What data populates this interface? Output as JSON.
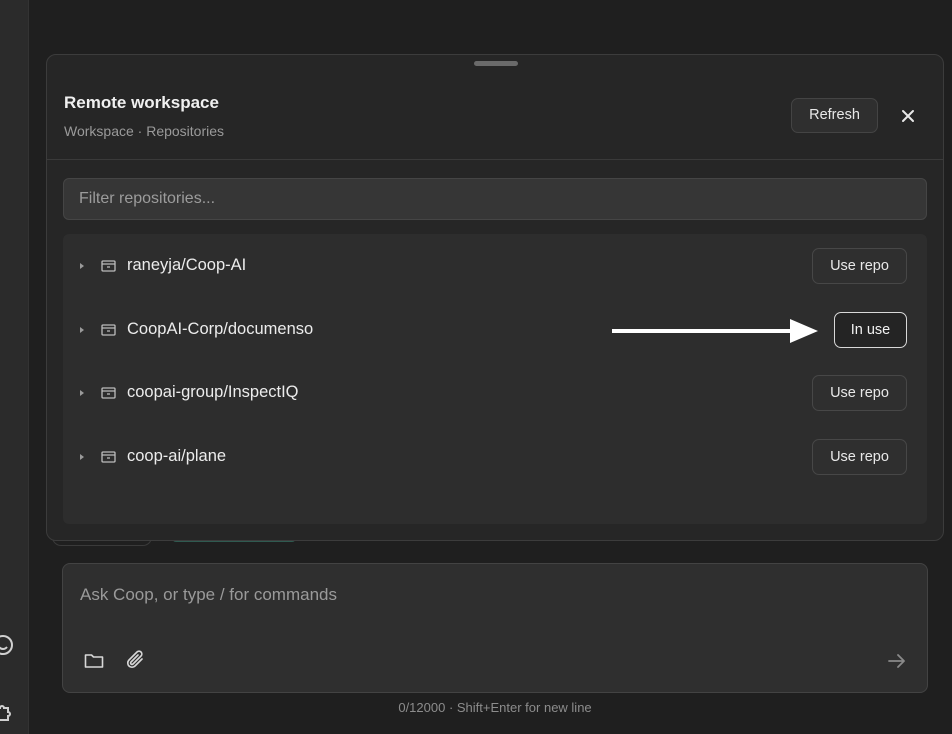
{
  "panel": {
    "title": "Remote workspace",
    "subtitle": "Workspace · Repositories",
    "refresh_label": "Refresh",
    "filter_placeholder": "Filter repositories..."
  },
  "repositories": [
    {
      "name": "raneyja/Coop-AI",
      "action_label": "Use repo",
      "in_use": false
    },
    {
      "name": "CoopAI-Corp/documenso",
      "action_label": "In use",
      "in_use": true
    },
    {
      "name": "coopai-group/InspectIQ",
      "action_label": "Use repo",
      "in_use": false
    },
    {
      "name": "coop-ai/plane",
      "action_label": "Use repo",
      "in_use": false
    }
  ],
  "composer": {
    "placeholder": "Ask Coop, or type / for commands",
    "hint": "0/12000 · Shift+Enter for new line"
  },
  "icons": {
    "close": "close-icon",
    "chevron": "chevron-right-icon",
    "repo": "repository-icon",
    "folder": "folder-icon",
    "attach": "paperclip-icon",
    "send": "arrow-right-icon",
    "annotation": "arrow-annotation"
  },
  "colors": {
    "background": "#1f1f1f",
    "panel": "#262626",
    "list": "#2d2d2d",
    "in_use_border": "#d8d8d8"
  }
}
